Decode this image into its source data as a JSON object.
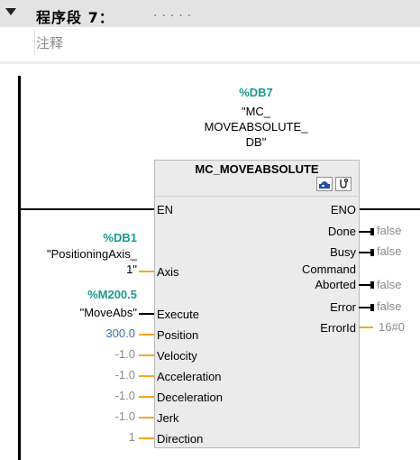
{
  "network": {
    "title": "程序段 7：",
    "dots": ".....",
    "comment": "注释"
  },
  "instance": {
    "address": "%DB7",
    "name_lines": [
      "\"MC_",
      "MOVEABSOLUTE_",
      "DB\""
    ]
  },
  "block": {
    "title": "MC_MOVEABSOLUTE",
    "icons": [
      "block-view-icon",
      "block-monitor-icon"
    ],
    "inputs": [
      "EN",
      "Axis",
      "Execute",
      "Position",
      "Velocity",
      "Acceleration",
      "Deceleration",
      "Jerk",
      "Direction"
    ],
    "outputs": [
      "ENO",
      "Done",
      "Busy",
      "Command",
      "Aborted",
      "Error",
      "ErrorId"
    ]
  },
  "params": {
    "axis": {
      "address": "%DB1",
      "name_lines": [
        "\"PositioningAxis_",
        "1\""
      ]
    },
    "execute": {
      "address": "%M200.5",
      "name": "\"MoveAbs\""
    },
    "position": "300.0",
    "velocity": "-1.0",
    "acceleration": "-1.0",
    "deceleration": "-1.0",
    "jerk": "-1.0",
    "direction": "1"
  },
  "outputs_values": {
    "done": "false",
    "busy": "false",
    "command_aborted": "false",
    "error": "false",
    "error_id": "16#0"
  },
  "colors": {
    "address": "#1a9a8e",
    "wire": "#f5a623",
    "value_blue": "#3d6db5",
    "value_grey": "#8a8a8a"
  }
}
